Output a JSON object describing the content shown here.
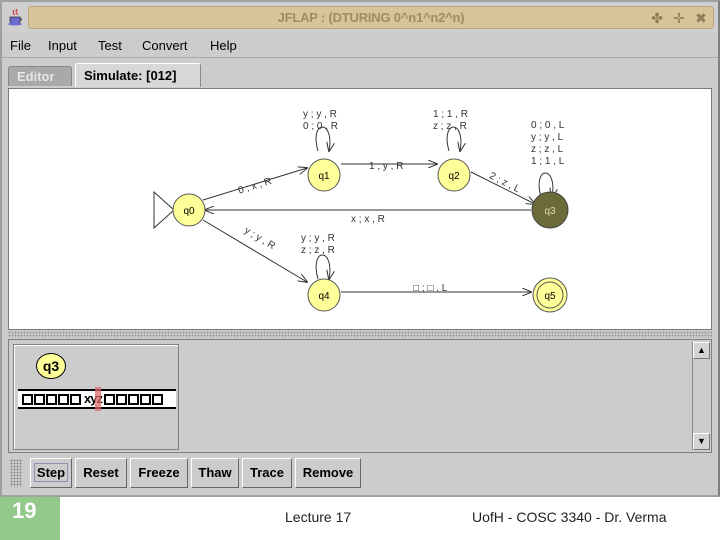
{
  "window": {
    "title": "JFLAP : (DTURING 0^n1^n2^n)",
    "controls": [
      "minimize-icon",
      "maximize-icon",
      "close-icon"
    ]
  },
  "menu": [
    "File",
    "Input",
    "Test",
    "Convert",
    "Help"
  ],
  "tabs": [
    {
      "label": "Editor",
      "active": false
    },
    {
      "label": "Simulate: [012]",
      "active": true
    }
  ],
  "automaton": {
    "states": [
      {
        "id": "q0",
        "initial": true,
        "final": false,
        "highlighted": false
      },
      {
        "id": "q1",
        "initial": false,
        "final": false,
        "highlighted": false
      },
      {
        "id": "q2",
        "initial": false,
        "final": false,
        "highlighted": false
      },
      {
        "id": "q3",
        "initial": false,
        "final": false,
        "highlighted": true
      },
      {
        "id": "q4",
        "initial": false,
        "final": false,
        "highlighted": false
      },
      {
        "id": "q5",
        "initial": false,
        "final": true,
        "highlighted": false
      }
    ],
    "transitions": [
      {
        "from": "q0",
        "to": "q1",
        "labels": [
          "0 ; x , R"
        ]
      },
      {
        "from": "q1",
        "to": "q1",
        "labels": [
          "y ; y , R",
          "0 ; 0 , R"
        ]
      },
      {
        "from": "q1",
        "to": "q2",
        "labels": [
          "1 ; y , R"
        ]
      },
      {
        "from": "q2",
        "to": "q2",
        "labels": [
          "1 ; 1 , R",
          "z ; z , R"
        ]
      },
      {
        "from": "q2",
        "to": "q3",
        "labels": [
          "2 ; z , L"
        ]
      },
      {
        "from": "q3",
        "to": "q3",
        "labels": [
          "0 ; 0 , L",
          "y ; y , L",
          "z ; z , L",
          "1 ; 1 , L"
        ]
      },
      {
        "from": "q3",
        "to": "q0",
        "labels": [
          "x ; x , R"
        ]
      },
      {
        "from": "q0",
        "to": "q4",
        "labels": [
          "y ; y , R"
        ]
      },
      {
        "from": "q4",
        "to": "q4",
        "labels": [
          "y ; y , R",
          "z ; z , R"
        ]
      },
      {
        "from": "q4",
        "to": "q5",
        "labels": [
          "□ ; □ , L"
        ]
      }
    ],
    "colors": {
      "state_fill": "#ffff99",
      "highlight_fill": "#6b6b3a",
      "edge": "#333333"
    }
  },
  "simulation": {
    "configurations": [
      {
        "state": "q3",
        "tape_left_blanks": 5,
        "tape_symbols": "xyz",
        "tape_right_blanks": 5,
        "head_on": "y"
      }
    ]
  },
  "toolbar": [
    "Step",
    "Reset",
    "Freeze",
    "Thaw",
    "Trace",
    "Remove"
  ],
  "slide": {
    "number": "19",
    "lecture": "Lecture 17",
    "credit": "UofH - COSC 3340 - Dr. Verma"
  }
}
